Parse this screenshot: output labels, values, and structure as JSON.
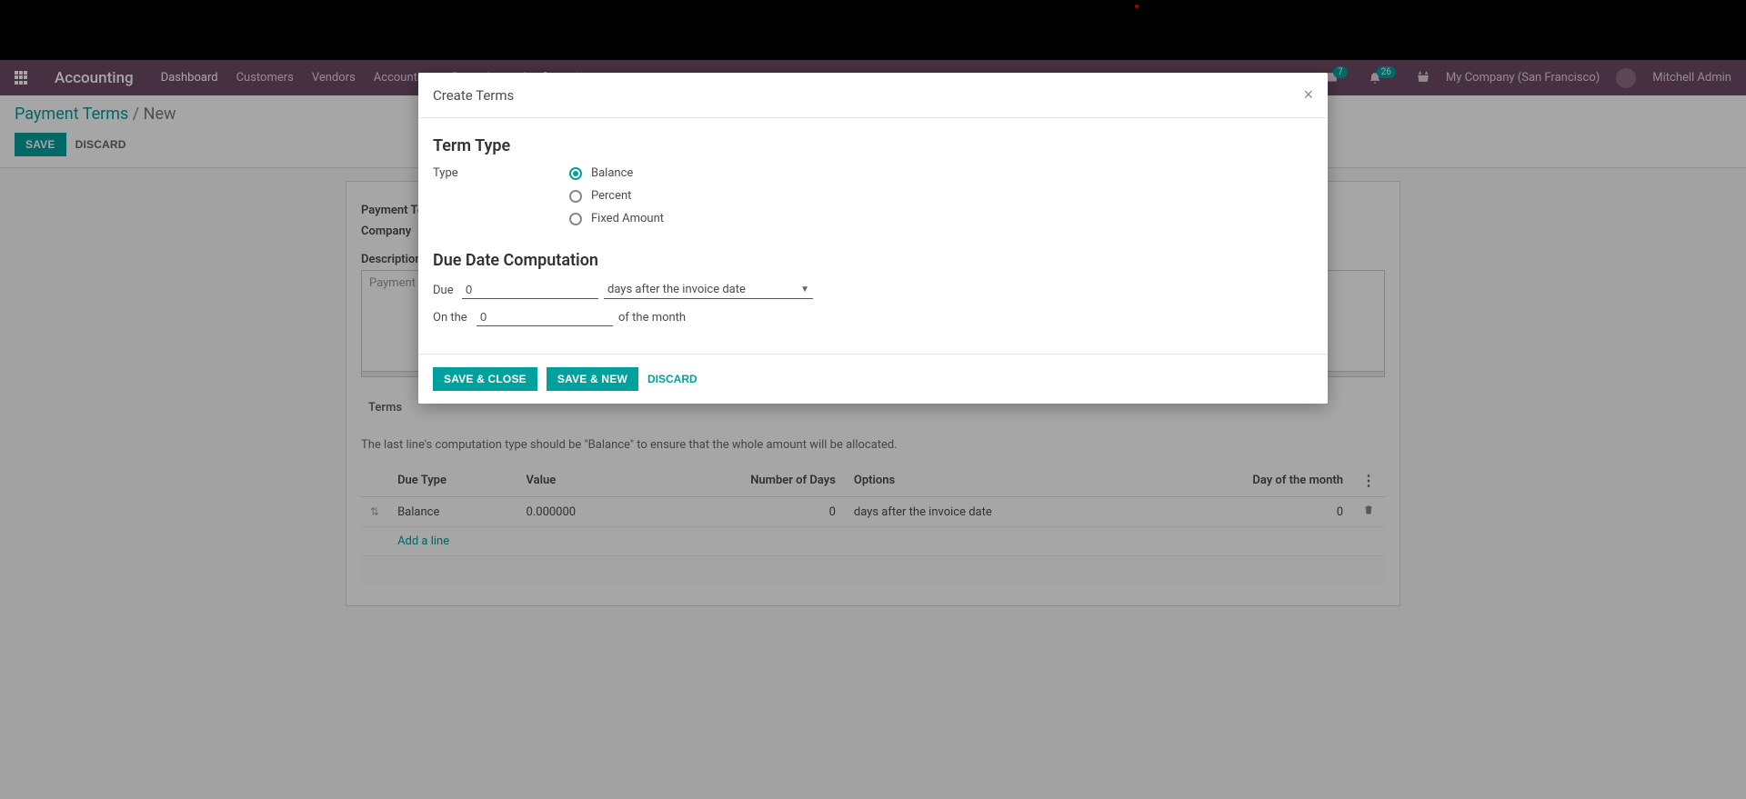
{
  "nav": {
    "app_title": "Accounting",
    "items": [
      "Dashboard",
      "Customers",
      "Vendors",
      "Accounting",
      "Reporting",
      "Configuration"
    ],
    "badge1": "7",
    "badge2": "26",
    "company": "My Company (San Francisco)",
    "user": "Mitchell Admin"
  },
  "breadcrumb": {
    "root": "Payment Terms",
    "current": "New"
  },
  "buttons": {
    "save": "Save",
    "discard": "Discard"
  },
  "form": {
    "payment_terms_label": "Payment Terms",
    "company_label": "Company",
    "description_label": "Description on the Invoice",
    "description_placeholder": "Payment terms explanation for the customer..."
  },
  "terms": {
    "tab_label": "Terms",
    "help_text": "The last line's computation type should be \"Balance\" to ensure that the whole amount will be allocated.",
    "columns": {
      "due_type": "Due Type",
      "value": "Value",
      "num_days": "Number of Days",
      "options": "Options",
      "day_month": "Day of the month"
    },
    "row": {
      "due_type": "Balance",
      "value": "0.000000",
      "num_days": "0",
      "options": "days after the invoice date",
      "day_month": "0"
    },
    "add_line": "Add a line"
  },
  "modal": {
    "title": "Create Terms",
    "section1": "Term Type",
    "type_label": "Type",
    "opt_balance": "Balance",
    "opt_percent": "Percent",
    "opt_fixed": "Fixed Amount",
    "section2": "Due Date Computation",
    "due_label": "Due",
    "due_value": "0",
    "due_select": "days after the invoice date",
    "on_label": "On the",
    "on_value": "0",
    "of_month": "of the month",
    "save_close": "Save & Close",
    "save_new": "Save & New",
    "discard": "Discard"
  }
}
